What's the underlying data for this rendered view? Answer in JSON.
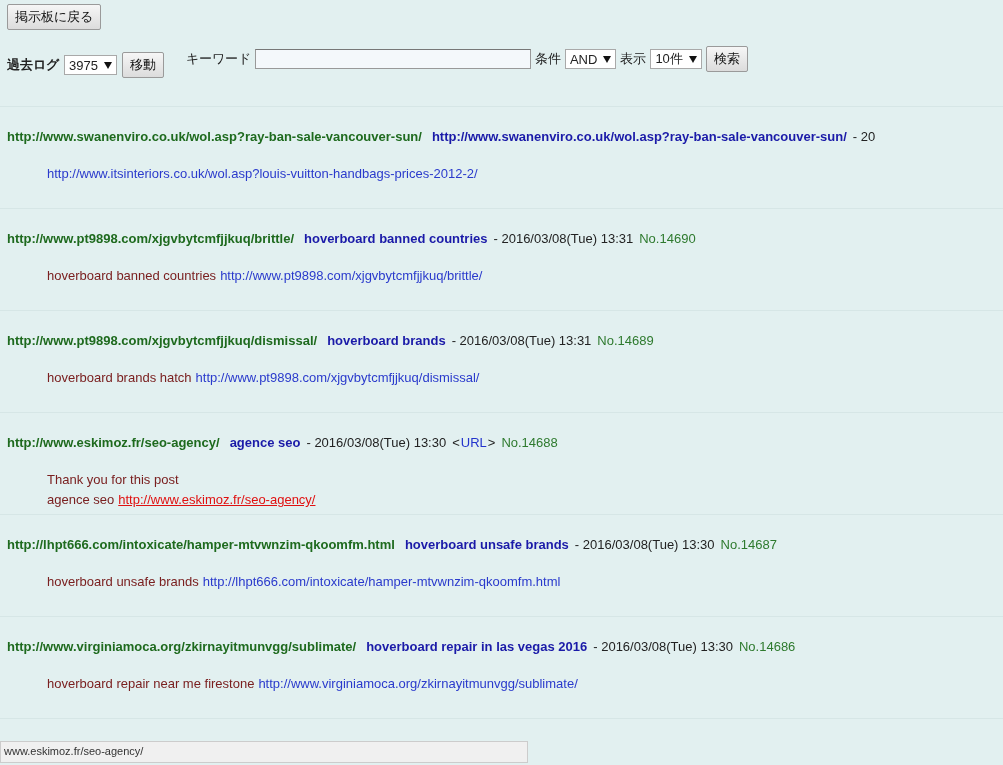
{
  "back_button": "掲示板に戻る",
  "log_form": {
    "label": "過去ログ",
    "select_value": "3975",
    "button": "移動"
  },
  "search_form": {
    "keyword_label": "キーワード",
    "condition_label": "条件",
    "condition_value": "AND",
    "display_label": "表示",
    "display_value": "10件",
    "button": "検索"
  },
  "posts": [
    {
      "subject": "http://www.swanenviro.co.uk/wol.asp?ray-ban-sale-vancouver-sun/",
      "name": "http://www.swanenviro.co.uk/wol.asp?ray-ban-sale-vancouver-sun/",
      "date": "- 20",
      "lines": [
        [
          {
            "kind": "link",
            "text": "http://www.itsinteriors.co.uk/wol.asp?louis-vuitton-handbags-prices-2012-2/"
          }
        ]
      ]
    },
    {
      "subject": "http://www.pt9898.com/xjgvbytcmfjjkuq/brittle/",
      "name": "hoverboard banned countries",
      "date": "- 2016/03/08(Tue) 13:31",
      "number": "No.14690",
      "lines": [
        [
          {
            "kind": "text",
            "text": "hoverboard banned countries"
          },
          {
            "kind": "link",
            "text": "http://www.pt9898.com/xjgvbytcmfjjkuq/brittle/"
          }
        ]
      ]
    },
    {
      "subject": "http://www.pt9898.com/xjgvbytcmfjjkuq/dismissal/",
      "name": "hoverboard brands",
      "date": "- 2016/03/08(Tue) 13:31",
      "number": "No.14689",
      "lines": [
        [
          {
            "kind": "text",
            "text": "hoverboard brands hatch"
          },
          {
            "kind": "link",
            "text": "http://www.pt9898.com/xjgvbytcmfjjkuq/dismissal/"
          }
        ]
      ]
    },
    {
      "subject": "http://www.eskimoz.fr/seo-agency/",
      "name": "agence seo",
      "date": "- 2016/03/08(Tue) 13:30",
      "url_link": {
        "open": "<",
        "label": "URL",
        "close": ">"
      },
      "number": "No.14688",
      "lines": [
        [
          {
            "kind": "text",
            "text": "Thank you for this post"
          }
        ],
        [
          {
            "kind": "text",
            "text": "agence seo"
          },
          {
            "kind": "hovered-link",
            "text": "http://www.eskimoz.fr/seo-agency/"
          }
        ]
      ]
    },
    {
      "subject": "http://lhpt666.com/intoxicate/hamper-mtvwnzim-qkoomfm.html",
      "name": "hoverboard unsafe brands",
      "date": "- 2016/03/08(Tue) 13:30",
      "number": "No.14687",
      "lines": [
        [
          {
            "kind": "text",
            "text": "hoverboard unsafe brands"
          },
          {
            "kind": "link",
            "text": "http://lhpt666.com/intoxicate/hamper-mtvwnzim-qkoomfm.html"
          }
        ]
      ]
    },
    {
      "subject": "http://www.virginiamoca.org/zkirnayitmunvgg/sublimate/",
      "name": "hoverboard repair in las vegas 2016",
      "date": "- 2016/03/08(Tue) 13:30",
      "number": "No.14686",
      "lines": [
        [
          {
            "kind": "text",
            "text": "hoverboard repair near me firestone"
          },
          {
            "kind": "link",
            "text": "http://www.virginiamoca.org/zkirnayitmunvgg/sublimate/"
          }
        ]
      ]
    }
  ],
  "status_bar": "www.eskimoz.fr/seo-agency/"
}
